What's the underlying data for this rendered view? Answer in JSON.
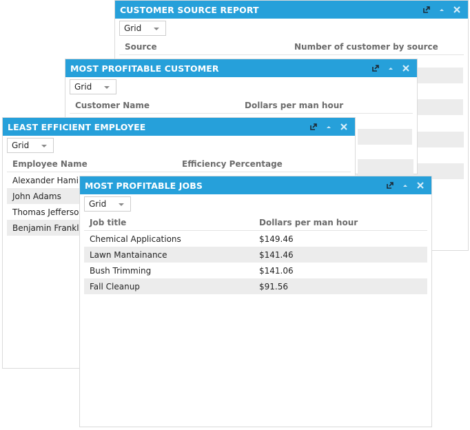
{
  "icons": {
    "popout": "popout-icon",
    "collapse": "collapse-icon",
    "close": "close-icon"
  },
  "colors": {
    "titlebar": "#26a0da",
    "alt_row": "#ececec",
    "header_text": "#6b6b6b"
  },
  "windows": {
    "customer_source": {
      "title": "CUSTOMER SOURCE REPORT",
      "view_select": "Grid",
      "columns": [
        "Source",
        "Number of customer by source"
      ],
      "rows": []
    },
    "profitable_customer": {
      "title": "MOST PROFITABLE CUSTOMER",
      "view_select": "Grid",
      "columns": [
        "Customer Name",
        "Dollars per man hour"
      ],
      "rows": []
    },
    "least_efficient": {
      "title": "LEAST EFFICIENT EMPLOYEE",
      "view_select": "Grid",
      "columns": [
        "Employee Name",
        "Efficiency Percentage"
      ],
      "rows": [
        {
          "name": "Alexander Hamilton"
        },
        {
          "name": "John Adams"
        },
        {
          "name": "Thomas Jefferson"
        },
        {
          "name": "Benjamin Franklin"
        }
      ]
    },
    "profitable_jobs": {
      "title": "MOST PROFITABLE JOBS",
      "view_select": "Grid",
      "columns": [
        "Job title",
        "Dollars per man hour"
      ],
      "rows": [
        {
          "title": "Chemical Applications",
          "value": "$149.46"
        },
        {
          "title": "Lawn Mantainance",
          "value": "$141.46"
        },
        {
          "title": "Bush Trimming",
          "value": "$141.06"
        },
        {
          "title": "Fall Cleanup",
          "value": "$91.56"
        }
      ]
    }
  }
}
